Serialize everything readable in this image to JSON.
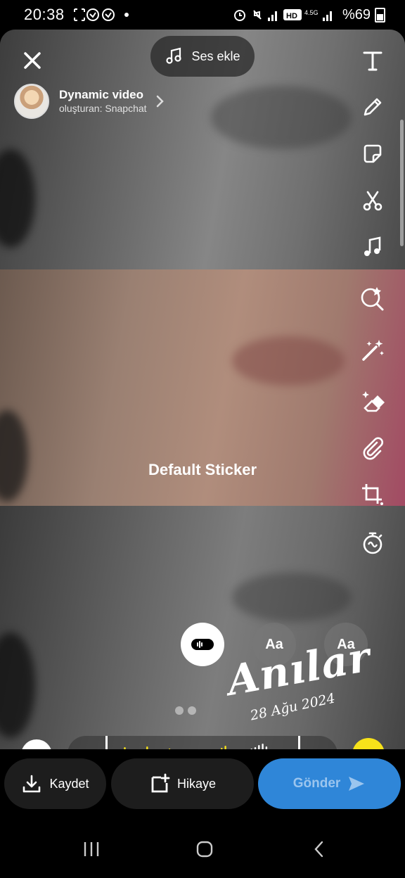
{
  "status_bar": {
    "time": "20:38",
    "battery_text": "%69",
    "network_label": "4.5G"
  },
  "editor": {
    "add_sound_label": "Ses ekle",
    "creator_title": "Dynamic video",
    "creator_subtitle": "oluşturan: Snapchat",
    "sticker_label": "Default Sticker"
  },
  "tools": [
    {
      "name": "text-tool",
      "icon": "text-icon"
    },
    {
      "name": "draw-tool",
      "icon": "pencil-icon"
    },
    {
      "name": "sticker-tool",
      "icon": "sticker-icon"
    },
    {
      "name": "scissors-tool",
      "icon": "scissors-icon"
    },
    {
      "name": "music-tool",
      "icon": "music-note-icon"
    },
    {
      "name": "lens-tool",
      "icon": "lens-search-icon"
    },
    {
      "name": "magic-tool",
      "icon": "magic-wand-icon"
    },
    {
      "name": "eraser-tool",
      "icon": "magic-eraser-icon"
    },
    {
      "name": "attachment-tool",
      "icon": "paperclip-icon"
    },
    {
      "name": "crop-tool",
      "icon": "crop-icon"
    },
    {
      "name": "timer-tool",
      "icon": "timer-icon"
    }
  ],
  "text_styles": {
    "aa_label_1": "Aa",
    "aa_label_2": "Aa"
  },
  "overlay_text": {
    "title": "Anılar",
    "date": "28 Ağu 2024"
  },
  "actions": {
    "save_label": "Kaydet",
    "story_label": "Hikaye",
    "send_label": "Gönder"
  },
  "colors": {
    "accent_yellow": "#f7e21a",
    "send_blue": "#2f86d8"
  }
}
